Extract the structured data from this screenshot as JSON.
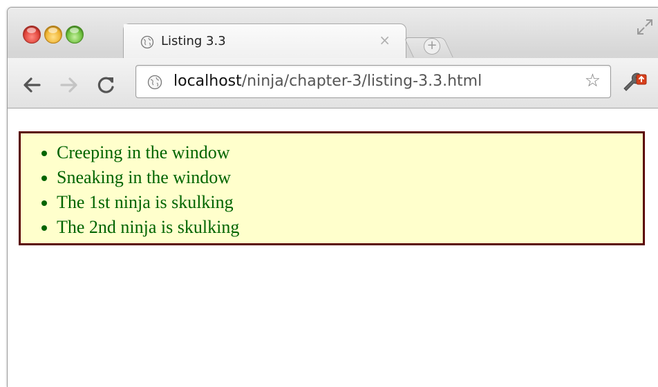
{
  "browser": {
    "tab_title": "Listing 3.3",
    "tab_close_symbol": "×",
    "new_tab_symbol": "+",
    "url_host": "localhost",
    "url_path": "/ninja/chapter-3/listing-3.3.html",
    "star_symbol": "☆",
    "icons": {
      "back": "back-arrow-icon",
      "forward": "forward-arrow-icon",
      "reload": "reload-icon",
      "favicon": "globe-icon",
      "bookmark": "star-icon",
      "menu": "wrench-icon",
      "fullscreen": "resize-icon"
    }
  },
  "page": {
    "items": [
      "Creeping in the window",
      "Sneaking in the window",
      "The 1st ninja is skulking",
      "The 2nd ninja is skulking"
    ]
  },
  "colors": {
    "list_background": "#ffffcc",
    "list_border": "#5a0000",
    "list_text": "#006400"
  }
}
